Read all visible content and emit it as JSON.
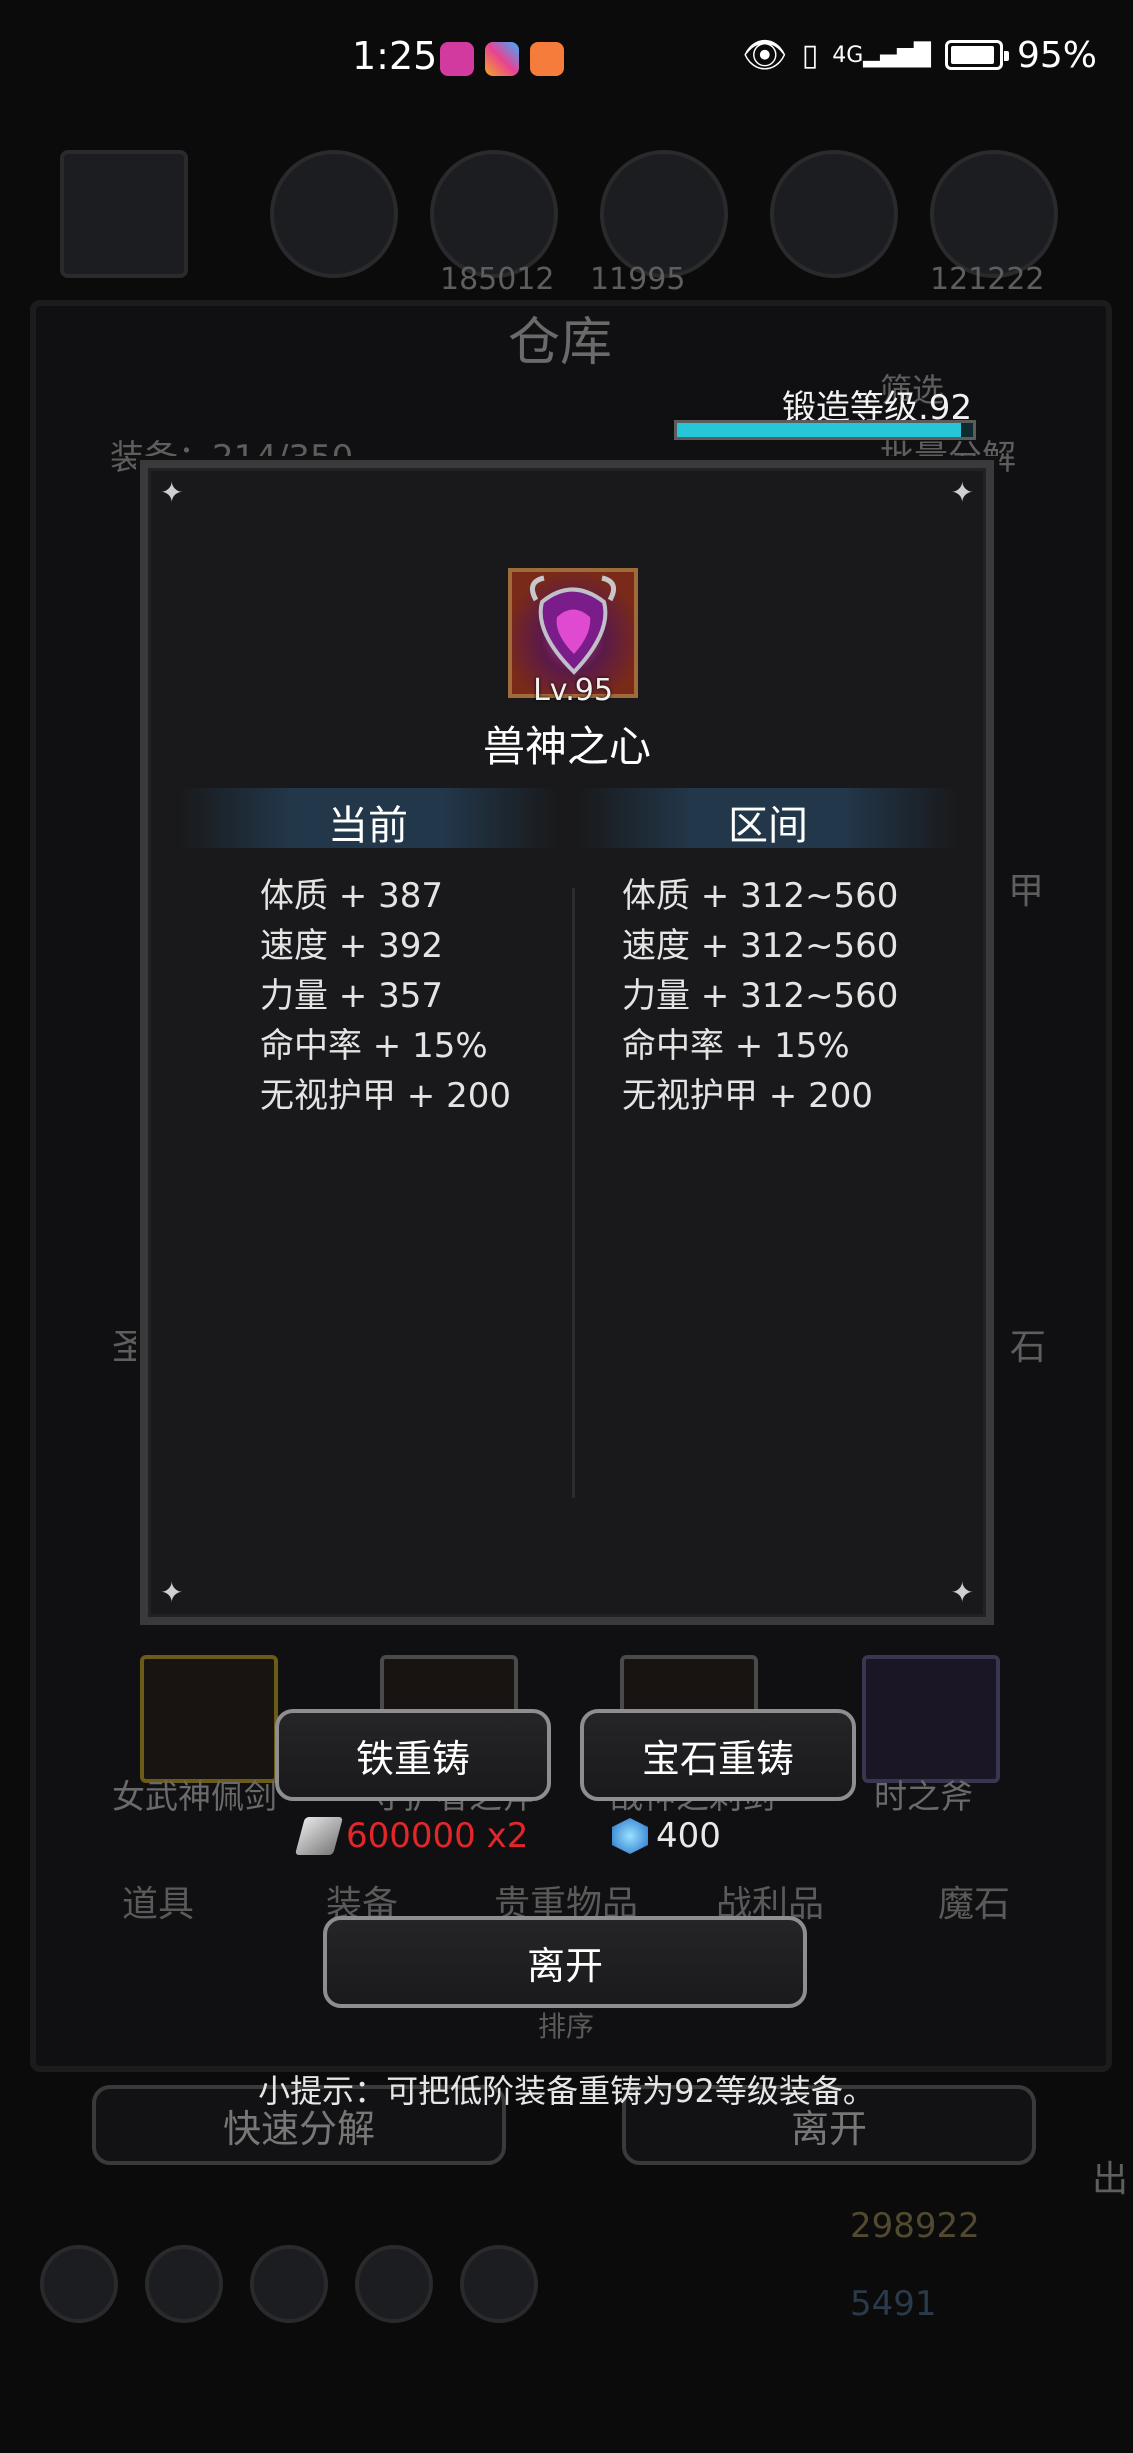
{
  "status_bar": {
    "time": "1:25",
    "battery": "95%",
    "battery_level": 0.95,
    "network": "4G"
  },
  "background": {
    "title": "仓库",
    "equip_count": "装备：214/350",
    "filter_button": "筛选",
    "batch_button": "批量分解",
    "top_numbers": [
      "185012",
      "11995",
      "121222"
    ],
    "tabs": [
      "道具",
      "装备",
      "贵重物品",
      "战利品",
      "魔石"
    ],
    "sort_button": "排序",
    "quick_decompose": "快速分解",
    "leave": "离开",
    "gold": "298922",
    "gems": "5491",
    "side_labels": [
      "甲",
      "圣",
      "石",
      "出"
    ]
  },
  "forge": {
    "label": "锻造等级.92",
    "progress": 0.96
  },
  "item": {
    "level": "Lv.95",
    "name": "兽神之心"
  },
  "columns": {
    "current": "当前",
    "range": "区间"
  },
  "current_stats": [
    "体质 + 387",
    "速度 + 392",
    "力量 + 357",
    "命中率 + 15%",
    "无视护甲 + 200"
  ],
  "range_stats": [
    "体质 + 312~560",
    "速度 + 312~560",
    "力量 + 312~560",
    "命中率 + 15%",
    "无视护甲 + 200"
  ],
  "slots": [
    "女武神佩剑",
    "守护者之斧",
    "战神之刺剑",
    "时之斧"
  ],
  "buttons": {
    "iron_recast": "铁重铸",
    "gem_recast": "宝石重铸",
    "leave": "离开"
  },
  "costs": {
    "iron": "600000 x2",
    "iron_color": "#e3262a",
    "gem": "400",
    "gem_color": "#3aa0e8"
  },
  "tip": "小提示：可把低阶装备重铸为92等级装备。"
}
